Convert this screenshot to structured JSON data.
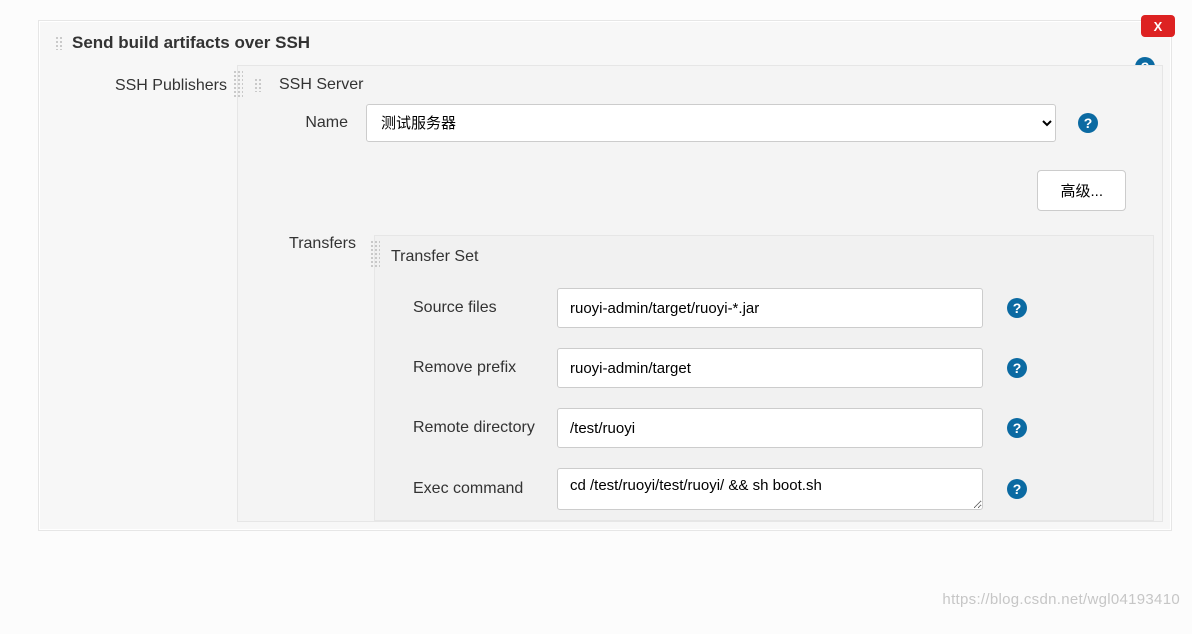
{
  "section": {
    "title": "Send build artifacts over SSH",
    "close_label": "X"
  },
  "publishers": {
    "label": "SSH Publishers",
    "server": {
      "title": "SSH Server",
      "name_label": "Name",
      "name_value": "测试服务器",
      "advanced_label": "高级..."
    },
    "transfers": {
      "label": "Transfers",
      "set": {
        "title": "Transfer Set",
        "source_label": "Source files",
        "source_value": "ruoyi-admin/target/ruoyi-*.jar",
        "remove_label": "Remove prefix",
        "remove_value": "ruoyi-admin/target",
        "remote_label": "Remote directory",
        "remote_value": "/test/ruoyi",
        "exec_label": "Exec command",
        "exec_value": "cd /test/ruoyi/test/ruoyi/ && sh boot.sh"
      }
    }
  },
  "watermark": "https://blog.csdn.net/wgl04193410"
}
